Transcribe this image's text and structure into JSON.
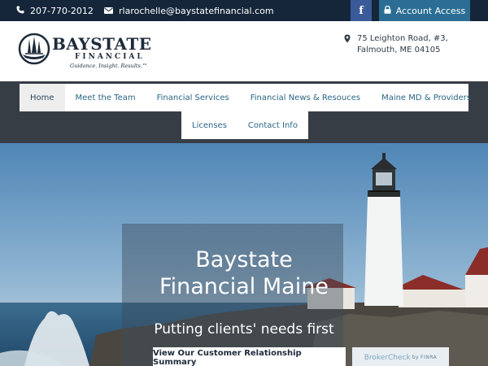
{
  "topbar": {
    "phone_icon": "phone-icon",
    "phone": "207-770-2012",
    "email_icon": "envelope-icon",
    "email": "rlarochelle@baystatefinancial.com",
    "facebook_icon": "facebook-icon",
    "facebook_glyph": "f",
    "account_icon": "lock-icon",
    "account_label": "Account Access"
  },
  "header": {
    "logo_main": "BAYSTATE",
    "logo_sub": "FINANCIAL",
    "logo_tagline": "Guidance. Insight. Results.™",
    "address_icon": "map-pin-icon",
    "address_line1": "75 Leighton Road, #3,",
    "address_line2": "Falmouth, ME 04105"
  },
  "nav": {
    "row1": [
      {
        "label": "Home",
        "active": true
      },
      {
        "label": "Meet the Team"
      },
      {
        "label": "Financial Services"
      },
      {
        "label": "Financial News & Resouces"
      },
      {
        "label": "Maine MD & Providers"
      }
    ],
    "row2": [
      {
        "label": "Licenses"
      },
      {
        "label": "Contact Info"
      }
    ]
  },
  "hero": {
    "title_line1": "Baystate",
    "title_line2": "Financial Maine",
    "subtitle": "Putting clients' needs first",
    "crs_button": "View Our Customer Relationship Summary",
    "broker_check": "BrokerCheck",
    "broker_by": "by",
    "broker_finra": "FINRA"
  },
  "colors": {
    "topbar_bg": "#15263a",
    "facebook_blue": "#3b5a9a",
    "account_blue": "#2b6d94",
    "nav_bg": "#373d44",
    "nav_link": "#2a6686"
  }
}
